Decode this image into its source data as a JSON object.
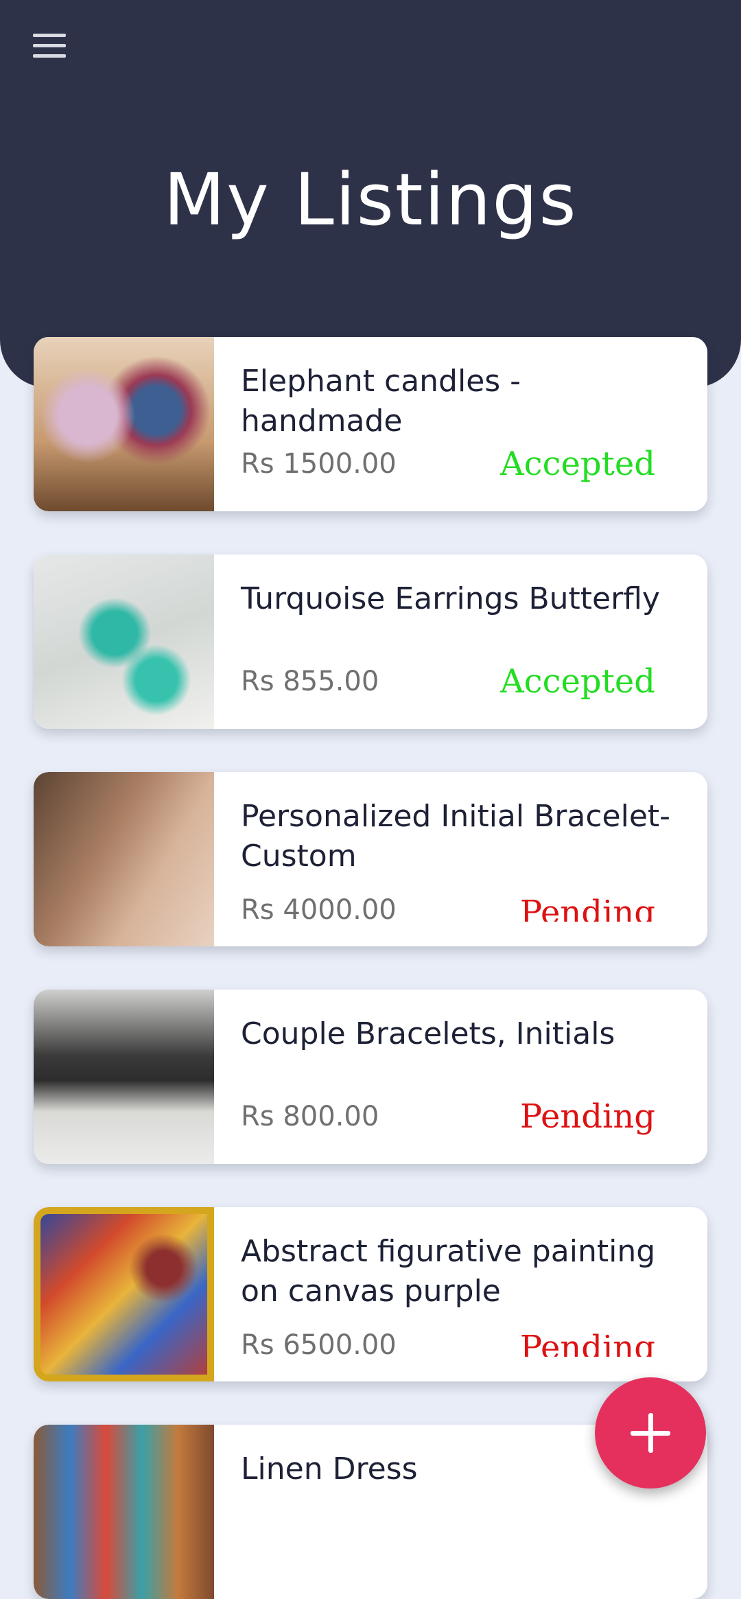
{
  "header": {
    "menu_icon": "hamburger-menu-icon",
    "title": "My Listings"
  },
  "colors": {
    "header_bg": "#2e3249",
    "page_bg": "#e8edf7",
    "accepted": "#22dd22",
    "pending": "#dd1111",
    "fab": "#e5305e"
  },
  "listings": [
    {
      "title": "Elephant candles - handmade",
      "price": "Rs 1500.00",
      "status": "Accepted"
    },
    {
      "title": "Turquoise Earrings Butterfly",
      "price": "Rs 855.00",
      "status": "Accepted"
    },
    {
      "title": "Personalized Initial Bracelet-Custom",
      "price": "Rs 4000.00",
      "status": "Pending"
    },
    {
      "title": "Couple Bracelets, Initials",
      "price": "Rs 800.00",
      "status": "Pending"
    },
    {
      "title": "Abstract figurative painting on canvas purple",
      "price": "Rs 6500.00",
      "status": "Pending"
    },
    {
      "title": "Linen Dress",
      "price": "",
      "status": ""
    }
  ],
  "fab": {
    "icon": "plus-icon"
  }
}
